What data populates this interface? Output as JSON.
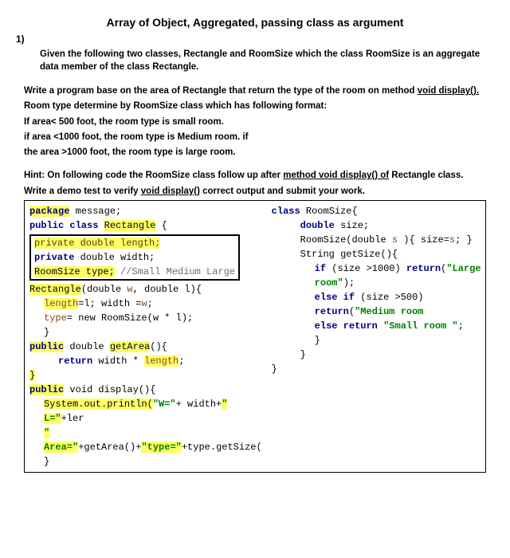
{
  "title": "Array of Object, Aggregated, passing class as argument",
  "qnum": "1)",
  "intro": "Given the following two classes, Rectangle and RoomSize which the class RoomSize is an aggregate data member of the class Rectangle.",
  "p1_a": "Write a program base on the area of Rectangle that return the type of the room on method ",
  "p1_b": "void display().",
  "p2": "Room type determine by RoomSize class which has following format:",
  "p3": "If area< 500 foot, the room type is small room.",
  "p4": "if area <1000 foot, the room type is  Medium room. if",
  "p5": "the area >1000  foot, the room type is large room.",
  "hint_a": "Hint: On following code the RoomSize class follow up after ",
  "hint_b": "method void display()  of",
  "hint_c": " Rectangle class.",
  "write_a": "Write a demo test to verify ",
  "write_b": "void display()",
  "write_c": " correct output and submit your work.",
  "code": {
    "l1_a": "package",
    "l1_b": " message;",
    "l2_a": "public class ",
    "l2_b": "Rectangle",
    "l2_c": " {",
    "l3_a": "private  double length;",
    "l4_a": "private",
    "l4_b": "  double width;",
    "l5_a": "RoomSize type;",
    "l5_b": "   //Small Medium Large",
    "l6_a": "Rectangle",
    "l6_b": "(double ",
    "l6_c": "w",
    "l6_d": ", double l){",
    "l7_a": "length",
    "l7_b": "=l; width =",
    "l7_c": "w",
    "l7_d": ";",
    "l8_a": "type",
    "l8_b": "= new RoomSize(w * l);",
    "l9": "}",
    "l10_a": "public",
    "l10_b": " double ",
    "l10_c": "getArea",
    "l10_d": "(){",
    "l11_a": "return",
    "l11_b": " width * ",
    "l11_c": "length",
    "l11_d": ";",
    "l12": "}",
    "l13_a": "public",
    "l13_b": "  void display(){",
    "l14_a": "System.out.println(",
    "l14_b": "\"W=\"",
    "l14_c": "+ width+",
    "l14_d": "\" L=\"",
    "l14_e": "+ler",
    "l15_a": "\" Area=\"",
    "l15_b": "+getArea()+",
    "l15_c": "\"type=\"",
    "l15_d": "+type.getSize(",
    "l16": "}",
    "r1_a": "class",
    "r1_b": " RoomSize{",
    "r2_a": "double",
    "r2_b": " size;",
    "r3_a": "RoomSize(double ",
    "r3_b": "s",
    "r3_c": " ){  size=",
    "r3_d": "s",
    "r3_e": "; }",
    "r4_a": "String getSize(){",
    "r5_a": "if",
    "r5_b": " (size >1000) ",
    "r5_c": "return",
    "r5_d": "(",
    "r5_e": "\"Large room\"",
    "r5_f": ");",
    "r6_a": "else if",
    "r6_b": " (size >500) ",
    "r6_c": "return",
    "r6_d": "(",
    "r6_e": "\"Medium room",
    "r7_a": "else return ",
    "r7_b": "\"Small room \"",
    "r7_c": ";",
    "r8": "}",
    "r9": "}",
    "r10": "}"
  }
}
